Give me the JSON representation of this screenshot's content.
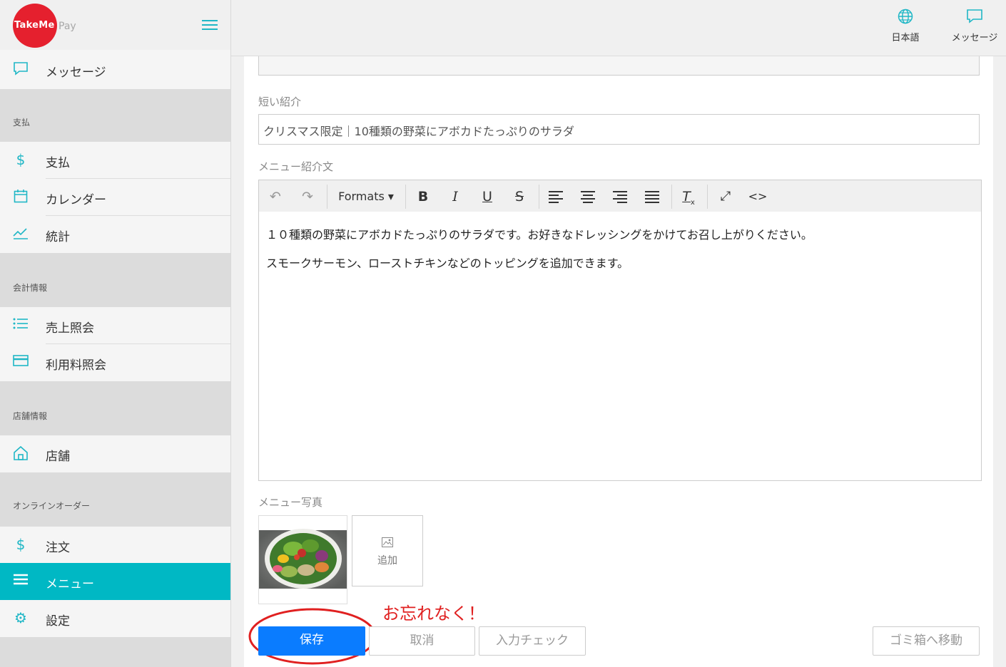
{
  "brand": {
    "logo_text": "TakeMe",
    "logo_suffix": "Pay"
  },
  "header": {
    "language_label": "日本語",
    "messages_label": "メッセージ"
  },
  "sidebar": {
    "top_item": "メッセージ",
    "sections": {
      "payment": "支払",
      "accounting": "会計情報",
      "store_info": "店舗情報",
      "online_order": "オンラインオーダー"
    },
    "items": {
      "payment": "支払",
      "calendar": "カレンダー",
      "stats": "統計",
      "sales": "売上照会",
      "fees": "利用料照会",
      "store": "店舗",
      "orders": "注文",
      "menu": "メニュー",
      "settings": "設定"
    }
  },
  "form": {
    "short_intro_label": "短い紹介",
    "short_intro_value": "クリスマス限定｜10種類の野菜にアボカドたっぷりのサラダ",
    "description_label": "メニュー紹介文",
    "toolbar": {
      "formats_label": "Formats"
    },
    "description_lines": [
      "１０種類の野菜にアボカドたっぷりのサラダです。お好きなドレッシングをかけてお召し上がりください。",
      "スモークサーモン、ローストチキンなどのトッピングを追加できます。"
    ],
    "photo_label": "メニュー写真",
    "add_photo_label": "追加"
  },
  "annotation": {
    "note": "お忘れなく！",
    "color": "#e02020"
  },
  "actions": {
    "save": "保存",
    "cancel": "取消",
    "check": "入力チェック",
    "trash": "ゴミ箱へ移動"
  },
  "colors": {
    "accent": "#00b8c4",
    "primary_button": "#0a7cff",
    "logo_red": "#e5202e"
  }
}
